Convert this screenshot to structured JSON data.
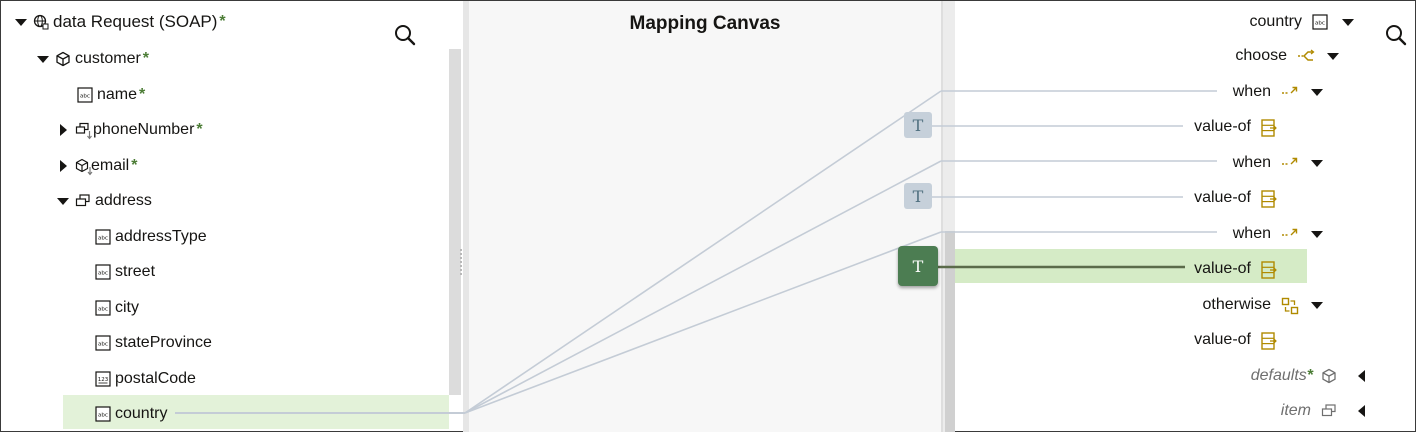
{
  "source_tree": {
    "items": [
      {
        "label": "data Request (SOAP)",
        "required": "*",
        "icon": "globe-node-icon",
        "toggle": "expanded"
      },
      {
        "label": "customer",
        "required": "*",
        "icon": "cube-icon",
        "toggle": "expanded"
      },
      {
        "label": "name",
        "required": "*",
        "icon": "string-field-icon",
        "toggle": "none"
      },
      {
        "label": "phoneNumber",
        "required": "*",
        "icon": "repeating-group-icon",
        "toggle": "collapsed"
      },
      {
        "label": "email",
        "required": "*",
        "icon": "repeating-cube-icon",
        "toggle": "collapsed"
      },
      {
        "label": "address",
        "required": "",
        "icon": "group-icon",
        "toggle": "expanded"
      },
      {
        "label": "addressType",
        "required": "",
        "icon": "string-field-icon",
        "toggle": "none"
      },
      {
        "label": "street",
        "required": "",
        "icon": "string-field-icon",
        "toggle": "none"
      },
      {
        "label": "city",
        "required": "",
        "icon": "string-field-icon",
        "toggle": "none"
      },
      {
        "label": "stateProvince",
        "required": "",
        "icon": "string-field-icon",
        "toggle": "none"
      },
      {
        "label": "postalCode",
        "required": "",
        "icon": "number-field-icon",
        "toggle": "none"
      },
      {
        "label": "country",
        "required": "",
        "icon": "string-field-icon",
        "toggle": "none",
        "selected": true
      }
    ]
  },
  "canvas": {
    "title": "Mapping Canvas",
    "function_glyph": "T"
  },
  "target_tree": {
    "items": [
      {
        "label": "country",
        "icon": "string-field-icon",
        "toggle": "expanded",
        "style": "normal",
        "required": ""
      },
      {
        "label": "choose",
        "icon": "choose-icon",
        "toggle": "expanded",
        "style": "normal",
        "required": ""
      },
      {
        "label": "when",
        "icon": "when-icon",
        "toggle": "expanded",
        "style": "normal",
        "required": ""
      },
      {
        "label": "value-of",
        "icon": "value-of-icon",
        "toggle": "none",
        "style": "normal",
        "required": ""
      },
      {
        "label": "when",
        "icon": "when-icon",
        "toggle": "expanded",
        "style": "normal",
        "required": ""
      },
      {
        "label": "value-of",
        "icon": "value-of-icon",
        "toggle": "none",
        "style": "normal",
        "required": ""
      },
      {
        "label": "when",
        "icon": "when-icon",
        "toggle": "expanded",
        "style": "normal",
        "required": ""
      },
      {
        "label": "value-of",
        "icon": "value-of-icon",
        "toggle": "none",
        "style": "normal",
        "required": "",
        "selected": true
      },
      {
        "label": "otherwise",
        "icon": "otherwise-icon",
        "toggle": "expanded",
        "style": "normal",
        "required": ""
      },
      {
        "label": "value-of",
        "icon": "value-of-icon",
        "toggle": "none",
        "style": "normal",
        "required": ""
      },
      {
        "label": "defaults",
        "icon": "cube-icon",
        "toggle": "collapsed-left",
        "style": "italic",
        "required": "*"
      },
      {
        "label": "item",
        "icon": "group-icon",
        "toggle": "collapsed-left",
        "style": "italic",
        "required": ""
      }
    ]
  },
  "colors": {
    "accent_green": "#4c7d52",
    "required_star": "#4c7d36",
    "selection_source": "#e3f2d9",
    "selection_target": "#d5ebc6",
    "mapping_line": "#c4ccd6",
    "active_line": "#5b6b4a",
    "xsl_icon": "#b08a00"
  }
}
